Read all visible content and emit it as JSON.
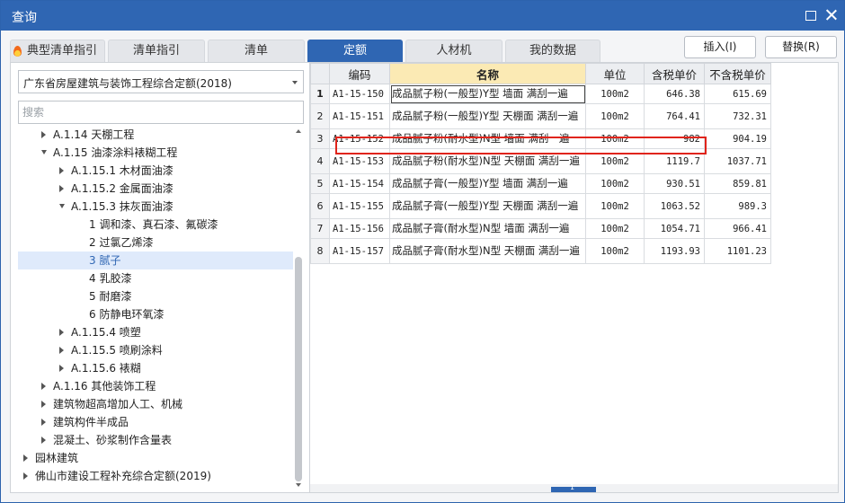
{
  "window": {
    "title": "查询"
  },
  "colors": {
    "titlebar": "#2f66b3",
    "active_tab": "#2f66b3",
    "name_header": "#fbeab4",
    "highlight": "#e0241b",
    "selected_tree": "#dfeafb"
  },
  "tabs": [
    {
      "label": "典型清单指引",
      "icon": "fire-icon"
    },
    {
      "label": "清单指引"
    },
    {
      "label": "清单"
    },
    {
      "label": "定额",
      "active": true
    },
    {
      "label": "人材机"
    },
    {
      "label": "我的数据"
    }
  ],
  "actions": {
    "insert": "插入(I)",
    "replace": "替换(R)"
  },
  "left": {
    "quota_select": "广东省房屋建筑与装饰工程综合定额(2018)",
    "search_placeholder": "搜索",
    "tree": [
      {
        "label": "A.1.14 天棚工程",
        "state": "collapsed"
      },
      {
        "label": "A.1.15 油漆涂料裱糊工程",
        "state": "expanded"
      },
      {
        "label": "A.1.15.1 木材面油漆",
        "state": "collapsed"
      },
      {
        "label": "A.1.15.2 金属面油漆",
        "state": "collapsed"
      },
      {
        "label": "A.1.15.3 抹灰面油漆",
        "state": "expanded"
      },
      {
        "label": "1 调和漆、真石漆、氟碳漆",
        "state": "leaf"
      },
      {
        "label": "2 过氯乙烯漆",
        "state": "leaf"
      },
      {
        "label": "3 腻子",
        "state": "leaf",
        "selected": true
      },
      {
        "label": "4 乳胶漆",
        "state": "leaf"
      },
      {
        "label": "5 耐磨漆",
        "state": "leaf"
      },
      {
        "label": "6 防静电环氧漆",
        "state": "leaf"
      },
      {
        "label": "A.1.15.4 喷塑",
        "state": "collapsed"
      },
      {
        "label": "A.1.15.5 喷刷涂料",
        "state": "collapsed"
      },
      {
        "label": "A.1.15.6 裱糊",
        "state": "collapsed"
      },
      {
        "label": "A.1.16 其他装饰工程",
        "state": "collapsed"
      },
      {
        "label": "建筑物超高增加人工、机械",
        "state": "collapsed"
      },
      {
        "label": "建筑构件半成品",
        "state": "collapsed"
      },
      {
        "label": "混凝土、砂浆制作含量表",
        "state": "collapsed"
      },
      {
        "label": "园林建筑",
        "state": "collapsed"
      },
      {
        "label": "佛山市建设工程补充综合定额(2019)",
        "state": "collapsed"
      }
    ]
  },
  "grid": {
    "headers": [
      "",
      "编码",
      "名称",
      "单位",
      "含税单价",
      "不含税单价"
    ],
    "rows": [
      {
        "no": "1",
        "code": "A1-15-150",
        "name": "成品腻子粉(一般型)Y型 墙面 满刮一遍",
        "unit": "100m2",
        "tax_price": "646.38",
        "notax_price": "615.69"
      },
      {
        "no": "2",
        "code": "A1-15-151",
        "name": "成品腻子粉(一般型)Y型 天棚面 满刮一遍",
        "unit": "100m2",
        "tax_price": "764.41",
        "notax_price": "732.31"
      },
      {
        "no": "3",
        "code": "A1-15-152",
        "name": "成品腻子粉(耐水型)N型 墙面 满刮一遍",
        "unit": "100m2",
        "tax_price": "982",
        "notax_price": "904.19"
      },
      {
        "no": "4",
        "code": "A1-15-153",
        "name": "成品腻子粉(耐水型)N型 天棚面 满刮一遍",
        "unit": "100m2",
        "tax_price": "1119.7",
        "notax_price": "1037.71"
      },
      {
        "no": "5",
        "code": "A1-15-154",
        "name": "成品腻子膏(一般型)Y型 墙面 满刮一遍",
        "unit": "100m2",
        "tax_price": "930.51",
        "notax_price": "859.81"
      },
      {
        "no": "6",
        "code": "A1-15-155",
        "name": "成品腻子膏(一般型)Y型 天棚面 满刮一遍",
        "unit": "100m2",
        "tax_price": "1063.52",
        "notax_price": "989.3"
      },
      {
        "no": "7",
        "code": "A1-15-156",
        "name": "成品腻子膏(耐水型)N型 墙面 满刮一遍",
        "unit": "100m2",
        "tax_price": "1054.71",
        "notax_price": "966.41"
      },
      {
        "no": "8",
        "code": "A1-15-157",
        "name": "成品腻子膏(耐水型)N型 天棚面 满刮一遍",
        "unit": "100m2",
        "tax_price": "1193.93",
        "notax_price": "1101.23"
      }
    ],
    "page_indicator": "1"
  }
}
